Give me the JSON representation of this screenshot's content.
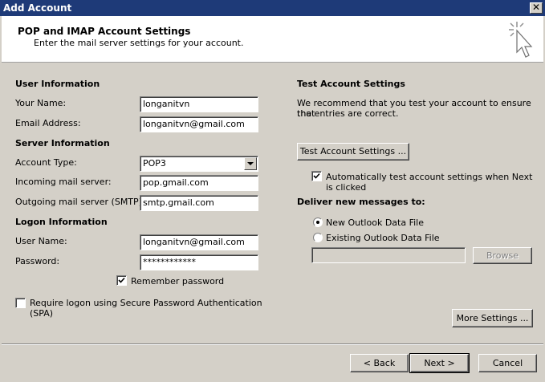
{
  "window": {
    "title": "Add Account",
    "close_symbol": "✕"
  },
  "header": {
    "title": "POP and IMAP Account Settings",
    "subtitle": "Enter the mail server settings for your account."
  },
  "user_info": {
    "heading": "User Information",
    "name_label": "Your Name:",
    "name_value": "longanitvn",
    "email_label": "Email Address:",
    "email_value": "longanitvn@gmail.com"
  },
  "server_info": {
    "heading": "Server Information",
    "account_type_label": "Account Type:",
    "account_type_value": "POP3",
    "incoming_label": "Incoming mail server:",
    "incoming_value": "pop.gmail.com",
    "outgoing_label": "Outgoing mail server (SMTP):",
    "outgoing_value": "smtp.gmail.com"
  },
  "logon_info": {
    "heading": "Logon Information",
    "username_label": "User Name:",
    "username_value": "longanitvn@gmail.com",
    "password_label": "Password:",
    "password_value": "************",
    "remember_label": "Remember password",
    "remember_checked": true,
    "spa_label_line1": "Require logon using Secure Password Authentication",
    "spa_label_line2": "(SPA)",
    "spa_checked": false
  },
  "test_settings": {
    "heading": "Test Account Settings",
    "desc_line1": "We recommend that you test your account to ensure that",
    "desc_line2": "the entries are correct.",
    "test_button": "Test Account Settings ...",
    "auto_test_line1": "Automatically test account settings when Next",
    "auto_test_line2": "is clicked",
    "auto_test_checked": true
  },
  "delivery": {
    "heading": "Deliver new messages to:",
    "option_new": "New Outlook Data File",
    "option_existing": "Existing Outlook Data File",
    "selected": "new",
    "existing_path": "",
    "browse_button": "Browse"
  },
  "buttons": {
    "more_settings": "More Settings ...",
    "back": "< Back",
    "next": "Next >",
    "cancel": "Cancel"
  }
}
